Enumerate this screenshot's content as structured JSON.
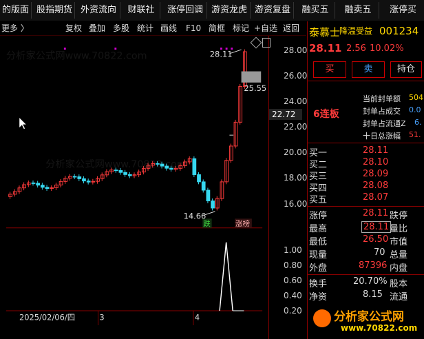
{
  "topbar": {
    "tabs": [
      "的版面",
      "股指期货",
      "外资流向",
      "财联社",
      "涨停回调",
      "游资龙虎",
      "游资复盘",
      "融买五",
      "融卖五",
      "涨停买"
    ]
  },
  "toolbar": {
    "more": "更多 〉",
    "items": [
      "复权",
      "叠加",
      "多股",
      "统计",
      "画线",
      "F10",
      "简框",
      "标记",
      "+自选",
      "返回"
    ]
  },
  "chart": {
    "price_axis": [
      "28.00",
      "26.00",
      "24.00",
      "22.00",
      "20.00",
      "18.00",
      "16.00"
    ],
    "vol_axis": [
      "1.00",
      "0.80",
      "0.60",
      "0.40",
      "0.20"
    ],
    "current_price_tag": "22.72",
    "high_label": "28.11",
    "low_label": "14.66",
    "right_label": "25.55",
    "tag_die": "跌",
    "tag_zhangbang": "涨榜",
    "date_label": "2025/02/06/四",
    "axis_mark_3": "3",
    "axis_mark_4": "4",
    "watermarks": [
      "分析家公式网www.70822.com",
      "分析家公式网www.70822.com"
    ]
  },
  "chart_data": {
    "type": "candlestick",
    "ylim": [
      14,
      29
    ],
    "high_marker": 28.11,
    "low_marker": 14.66
  },
  "panel": {
    "name": "泰慕士",
    "tag": "降温受益",
    "code": "001234",
    "price": "28.11",
    "change": "2.56",
    "pct": "10.02%",
    "buy": "买",
    "sell": "卖",
    "hold": "持仓",
    "streak": "6连板",
    "seal_rows": [
      {
        "label": "当前封单额",
        "val": "504"
      },
      {
        "label": "封单占成交",
        "val": "0.0"
      },
      {
        "label": "封单占流通Z",
        "val": "6."
      },
      {
        "label": "十日总涨幅",
        "val": "51."
      }
    ],
    "bids": [
      {
        "label": "买一",
        "val": "28.11"
      },
      {
        "label": "买二",
        "val": "28.10"
      },
      {
        "label": "买三",
        "val": "28.09"
      },
      {
        "label": "买四",
        "val": "28.08"
      },
      {
        "label": "买五",
        "val": "28.07"
      }
    ],
    "stats": [
      {
        "l1": "涨停",
        "v1": "28.11",
        "l2": "跌停"
      },
      {
        "l1": "最高",
        "v1": "28.11",
        "l2": "量比"
      },
      {
        "l1": "最低",
        "v1": "26.50",
        "l2": "市值"
      },
      {
        "l1": "现量",
        "v1": "70",
        "l2": "总量"
      },
      {
        "l1": "外盘",
        "v1": "87396",
        "l2": "内盘"
      }
    ],
    "stats2": [
      {
        "l1": "换手",
        "v1": "20.70%",
        "l2": "股本"
      },
      {
        "l1": "净资",
        "v1": "8.15",
        "l2": "流通"
      }
    ],
    "logo_text": "分析家公式网",
    "logo_url": "www.70822.com"
  },
  "colors": {
    "up": "#ff3b3b",
    "down": "#36d8f0",
    "gold": "#ffd700"
  }
}
